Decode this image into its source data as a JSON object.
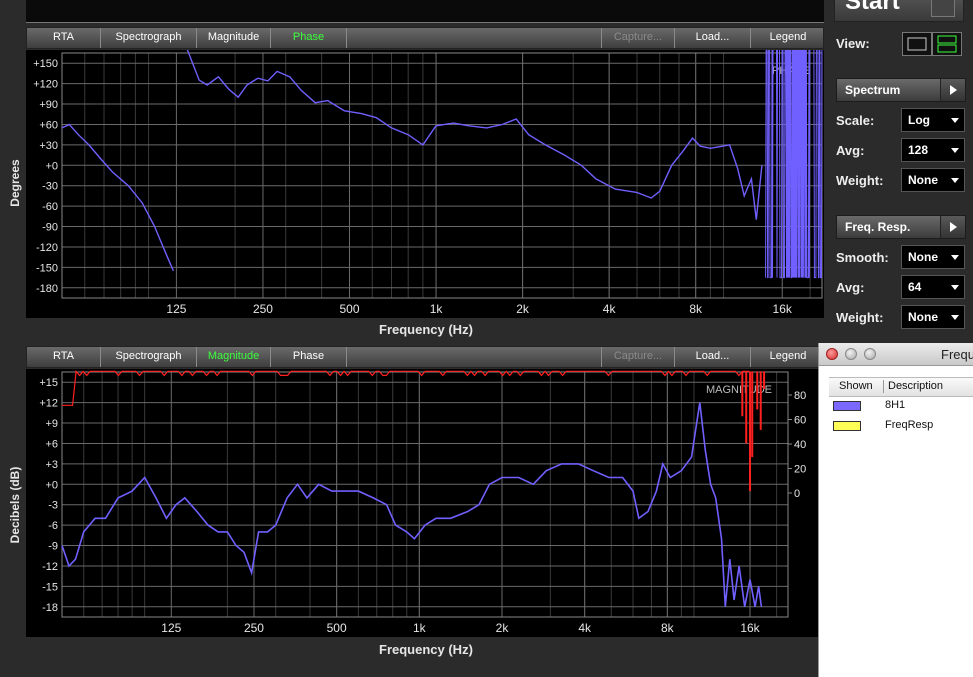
{
  "tabs_top": [
    "RTA",
    "Spectrograph",
    "Magnitude",
    "Phase"
  ],
  "tabs_top_active": "Phase",
  "tabs_right": [
    "Capture...",
    "Load...",
    "Legend"
  ],
  "phase_graph": {
    "title": "PHASE",
    "ylabel": "Degrees",
    "xlabel": "Frequency (Hz)",
    "y_ticks": [
      "+150",
      "+120",
      "+90",
      "+60",
      "+30",
      "+0",
      "-30",
      "-60",
      "-90",
      "-120",
      "-150",
      "-180"
    ],
    "x_ticks": [
      "125",
      "250",
      "500",
      "1k",
      "2k",
      "4k",
      "8k",
      "16k"
    ]
  },
  "magnitude_graph": {
    "title": "MAGNITUDE",
    "ylabel": "Decibels (dB)",
    "xlabel": "Frequency (Hz)",
    "y_ticks": [
      "+15",
      "+12",
      "+9",
      "+6",
      "+3",
      "+0",
      "-3",
      "-6",
      "-9",
      "-12",
      "-15",
      "-18"
    ],
    "x_ticks": [
      "125",
      "250",
      "500",
      "1k",
      "2k",
      "4k",
      "8k",
      "16k"
    ],
    "coherence_ticks": [
      "80",
      "60",
      "40",
      "20",
      "0"
    ]
  },
  "tabs_bottom": [
    "RTA",
    "Spectrograph",
    "Magnitude",
    "Phase"
  ],
  "tabs_bottom_active": "Magnitude",
  "sidebar": {
    "start_label": "Start",
    "view_label": "View:",
    "spectrum_label": "Spectrum",
    "scale_label": "Scale:",
    "scale_value": "Log",
    "avg_label": "Avg:",
    "avg_value": "128",
    "weight_label": "Weight:",
    "weight_value": "None",
    "freqresp_label": "Freq. Resp.",
    "smooth_label": "Smooth:",
    "smooth_value": "None",
    "fr_avg_label": "Avg:",
    "fr_avg_value": "64",
    "fr_weight_label": "Weight:",
    "fr_weight_value": "None"
  },
  "legend_window": {
    "title": "Frequ",
    "col_shown": "Shown",
    "col_description": "Description",
    "rows": [
      {
        "name": "8H1",
        "color": "#7b68ff"
      },
      {
        "name": "FreqResp",
        "color": "#ffff55"
      }
    ]
  },
  "colors": {
    "trace": "#7060ff",
    "coherence": "#ff2020",
    "active_tab": "#3cff3c"
  }
}
